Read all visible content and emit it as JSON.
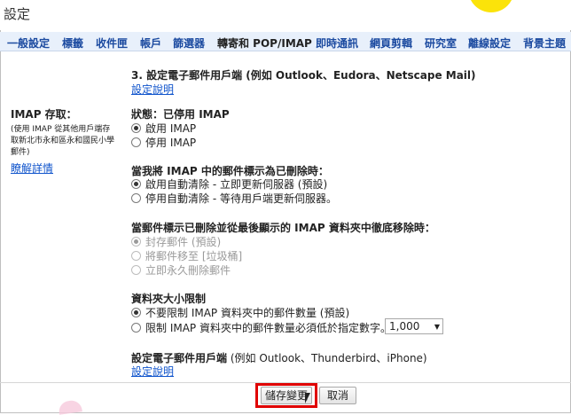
{
  "window": {
    "title": "設定"
  },
  "tabs": [
    {
      "label": "一般設定"
    },
    {
      "label": "標籤"
    },
    {
      "label": "收件匣"
    },
    {
      "label": "帳戶"
    },
    {
      "label": "篩選器"
    },
    {
      "label": "轉寄和 POP/IMAP",
      "active": true
    },
    {
      "label": "即時通訊"
    },
    {
      "label": "網頁剪輯"
    },
    {
      "label": "研究室"
    },
    {
      "label": "離線設定"
    },
    {
      "label": "背景主題"
    }
  ],
  "top_section": {
    "heading": "3. 設定電子郵件用戶端 (例如 Outlook、Eudora、Netscape Mail)",
    "link": "設定說明"
  },
  "sidebar": {
    "title": "IMAP 存取：",
    "description": "(使用 IMAP 從其他用戶端存取新北市永和區永和國民小學郵件)",
    "link": "瞭解詳情"
  },
  "imap_status": {
    "label": "狀態：",
    "value": "已停用 IMAP",
    "options": [
      "啟用 IMAP",
      "停用 IMAP"
    ],
    "selected": 0
  },
  "delete_behavior": {
    "heading": "當我將 IMAP 中的郵件標示為已刪除時：",
    "options": [
      "啟用自動清除 - 立即更新伺服器 (預設)",
      "停用自動清除 - 等待用戶端更新伺服器。"
    ],
    "selected": 0
  },
  "expunge_behavior": {
    "heading": "當郵件標示已刪除並從最後顯示的 IMAP 資料夾中徹底移除時：",
    "options": [
      "封存郵件 (預設)",
      "將郵件移至 [垃圾桶]",
      "立即永久刪除郵件"
    ],
    "selected": 0,
    "disabled": true
  },
  "folder_limit": {
    "heading": "資料夾大小限制",
    "options": [
      "不要限制 IMAP 資料夾中的郵件數量 (預設)",
      "限制 IMAP 資料夾中的郵件數量必須低於指定數字。"
    ],
    "selected": 0,
    "select_value": "1,000"
  },
  "client_config": {
    "heading_bold": "設定電子郵件用戶端",
    "heading_rest": " (例如 Outlook、Thunderbird、iPhone)",
    "link": "設定說明"
  },
  "buttons": {
    "save": "儲存變更",
    "cancel": "取消"
  },
  "colors": {
    "tab_text": "#1b4aa0",
    "tabs_bg": "#e8f0fb",
    "link": "#1155cc",
    "highlight": "#e00000"
  }
}
